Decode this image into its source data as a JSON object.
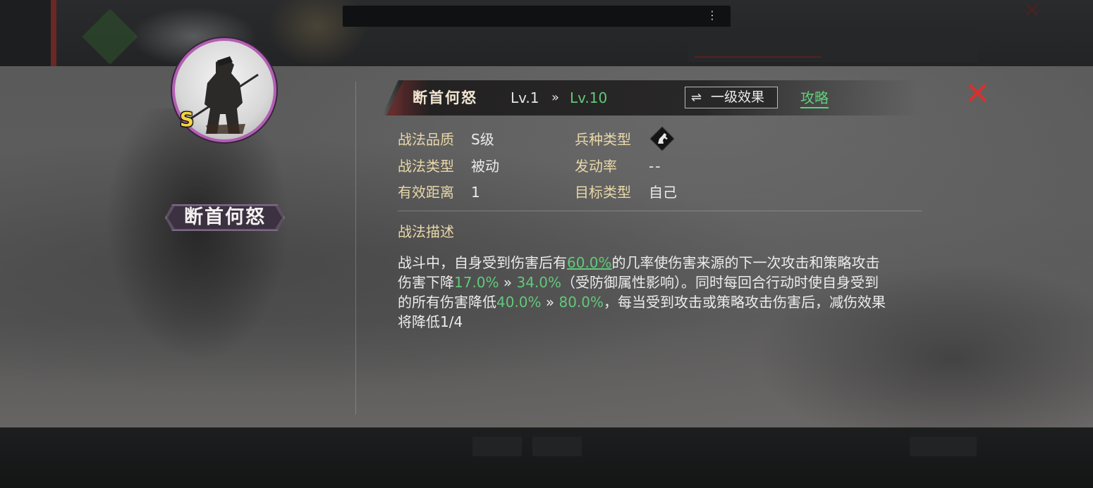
{
  "tactic": {
    "name": "断首何怒",
    "grade_badge": "S",
    "level_from": "Lv.1",
    "level_arrow": "»",
    "level_to": "Lv.10"
  },
  "header": {
    "effect_button_label": "一级效果",
    "effect_button_icon": "⇌",
    "guide_link": "攻略",
    "close_icon": "✕"
  },
  "attributes": {
    "quality_label": "战法品质",
    "quality_value": "S级",
    "troop_label": "兵种类型",
    "troop_icon": "horse-icon",
    "type_label": "战法类型",
    "type_value": "被动",
    "trigger_label": "发动率",
    "trigger_value": "--",
    "range_label": "有效距离",
    "range_value": "1",
    "target_label": "目标类型",
    "target_value": "自己"
  },
  "description": {
    "heading": "战法描述",
    "l1a": "战斗中，自身受到伤害后有",
    "l1b": "60.0%",
    "l1c": "的几率使伤害来源的下一次攻击和策略攻击",
    "l2a": "伤害下降",
    "l2b": "17.0%",
    "l2c": " » ",
    "l2d": "34.0%",
    "l2e": "（受防御属性影响）。同时每回合行动时使自身受到",
    "l3a": "的所有伤害降低",
    "l3b": "40.0%",
    "l3c": " » ",
    "l3d": "80.0%",
    "l3e": "，每当受到攻击或策略攻击伤害后，减伤效果",
    "l4": "将降低1/4"
  },
  "colors": {
    "highlight_green": "#62c97a",
    "label_gold": "#e8d7a8",
    "close_red": "#d8312b",
    "portrait_border": "#b25fb2",
    "grade_yellow": "#f0d342"
  },
  "background": {
    "top_bar_menu": "⋮"
  }
}
